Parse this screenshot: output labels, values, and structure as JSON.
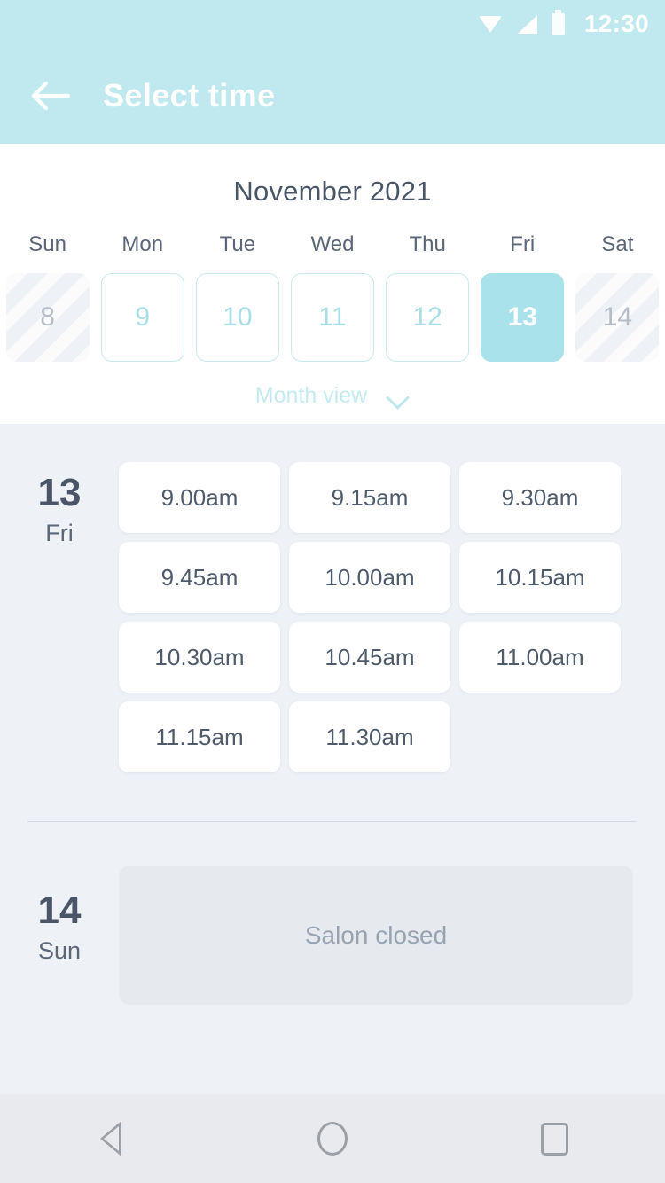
{
  "status_bar": {
    "clock": "12:30",
    "icons": [
      "wifi-icon",
      "signal-icon",
      "battery-icon"
    ]
  },
  "header": {
    "back_icon": "arrow-left-icon",
    "title": "Select time"
  },
  "calendar": {
    "month_label": "November 2021",
    "weekdays": [
      "Sun",
      "Mon",
      "Tue",
      "Wed",
      "Thu",
      "Fri",
      "Sat"
    ],
    "days": [
      {
        "number": "8",
        "state": "disabled"
      },
      {
        "number": "9",
        "state": "enabled"
      },
      {
        "number": "10",
        "state": "enabled"
      },
      {
        "number": "11",
        "state": "enabled"
      },
      {
        "number": "12",
        "state": "enabled"
      },
      {
        "number": "13",
        "state": "selected"
      },
      {
        "number": "14",
        "state": "disabled"
      }
    ],
    "month_view_label": "Month view",
    "month_view_icon": "chevron-down-icon"
  },
  "schedule": {
    "groups": [
      {
        "day_number": "13",
        "day_name": "Fri",
        "slots": [
          "9.00am",
          "9.15am",
          "9.30am",
          "9.45am",
          "10.00am",
          "10.15am",
          "10.30am",
          "10.45am",
          "11.00am",
          "11.15am",
          "11.30am"
        ]
      },
      {
        "day_number": "14",
        "day_name": "Sun",
        "closed_label": "Salon closed"
      }
    ]
  },
  "nav_bar": {
    "back_icon": "triangle-back-icon",
    "home_icon": "circle-home-icon",
    "recents_icon": "square-recents-icon"
  },
  "colors": {
    "accent": "#bfe9ef",
    "selected_day": "#a9e2ea",
    "text_dark": "#4a5568",
    "background": "#eef2f7"
  }
}
